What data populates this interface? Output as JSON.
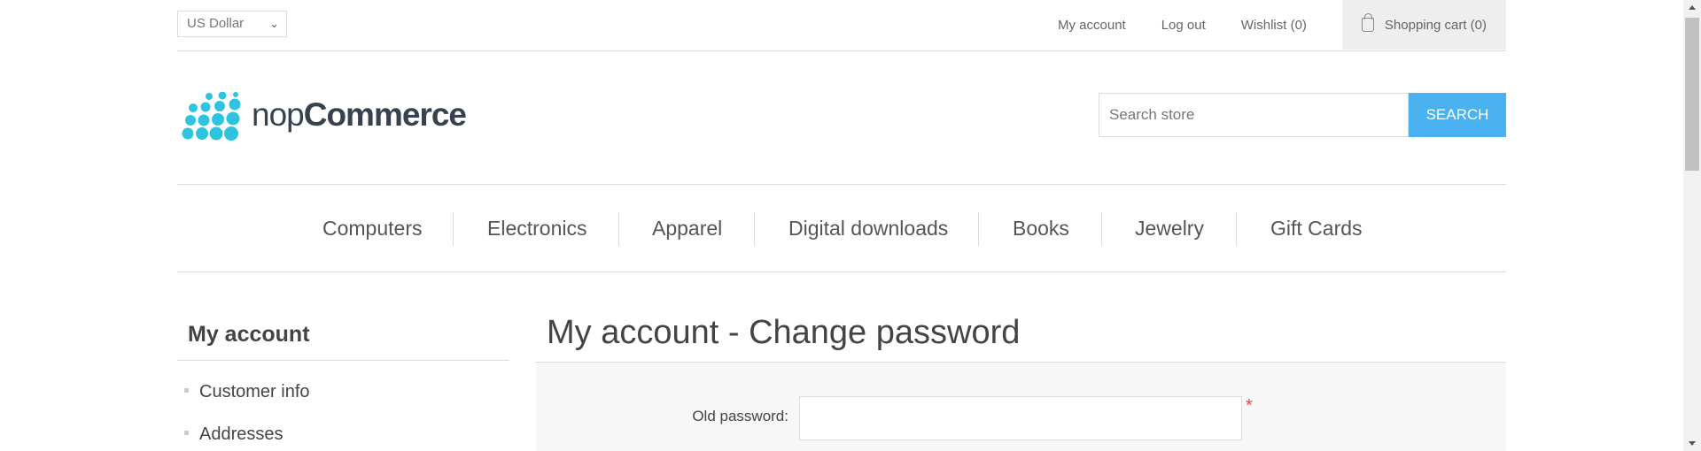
{
  "header": {
    "currency": "US Dollar",
    "links": {
      "my_account": "My account",
      "log_out": "Log out",
      "wishlist": "Wishlist (0)",
      "cart": "Shopping cart (0)"
    }
  },
  "logo": {
    "text_light": "nop",
    "text_bold": "Commerce"
  },
  "search": {
    "placeholder": "Search store",
    "button": "SEARCH"
  },
  "menu": [
    "Computers",
    "Electronics",
    "Apparel",
    "Digital downloads",
    "Books",
    "Jewelry",
    "Gift Cards"
  ],
  "sidebar": {
    "title": "My account",
    "items": [
      {
        "label": "Customer info"
      },
      {
        "label": "Addresses"
      }
    ]
  },
  "main": {
    "title": "My account - Change password",
    "old_password_label": "Old password:",
    "required_mark": "*"
  },
  "colors": {
    "accent": "#4ab2f1",
    "logo_dots": "#2ec4e0",
    "required": "#e4434b"
  },
  "icons": [
    "chevron-down-icon",
    "cart-icon",
    "logo-dots-icon",
    "bullet-icon"
  ]
}
